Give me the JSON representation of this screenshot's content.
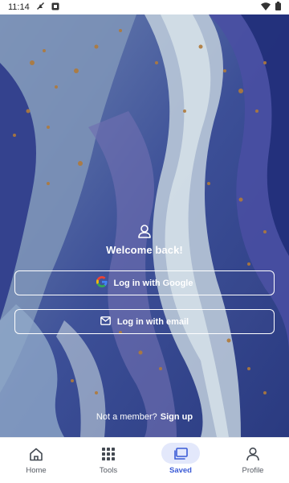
{
  "status_bar": {
    "time": "11:14"
  },
  "hero": {
    "welcome_text": "Welcome back!",
    "google_button_label": "Log in with Google",
    "email_button_label": "Log in with email",
    "signup_prompt": "Not a member?",
    "signup_link": "Sign up"
  },
  "bottom_nav": {
    "items": [
      {
        "label": "Home",
        "icon": "home-icon",
        "active": false
      },
      {
        "label": "Tools",
        "icon": "grid-icon",
        "active": false
      },
      {
        "label": "Saved",
        "icon": "saved-icon",
        "active": true
      },
      {
        "label": "Profile",
        "icon": "person-icon",
        "active": false
      }
    ]
  },
  "colors": {
    "accent": "#3b5bd6",
    "active_pill": "#e3e8fb",
    "hero_base": "#2b3f86"
  }
}
